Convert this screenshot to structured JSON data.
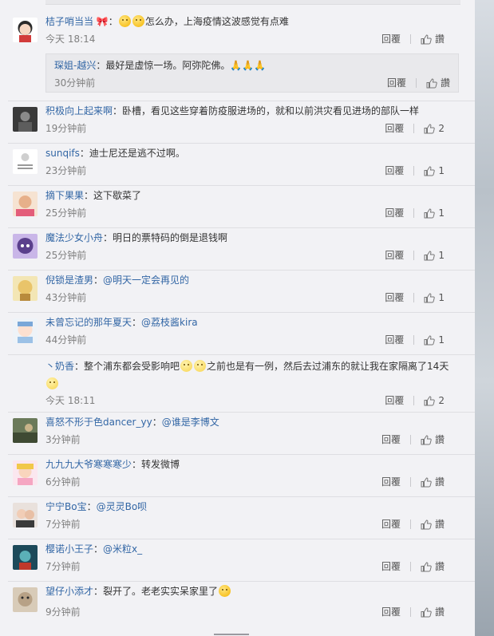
{
  "reply_label": "回覆",
  "like_label": "讚",
  "comments": [
    {
      "user": "桔子哨当当",
      "badge": "🎀",
      "text": "怎么办，上海疫情这波感觉有点难",
      "emoji_before": 2,
      "time": "今天 18:14",
      "likes": "讚",
      "reply": {
        "user": "琛姐-越兴",
        "text": "最好是虚惊一场。阿弥陀佛。🙏🙏🙏",
        "time": "30分钟前",
        "likes": "讚"
      }
    },
    {
      "user": "积极向上起来啊",
      "text": "卧槽，看见这些穿着防疫服进场的，就和以前洪灾看见进场的部队一样",
      "time": "19分钟前",
      "likes": "2"
    },
    {
      "user": "sunqifs",
      "text": "迪士尼还是逃不过啊。",
      "time": "23分钟前",
      "likes": "1"
    },
    {
      "user": "摘下果果",
      "text": "这下歇菜了",
      "time": "25分钟前",
      "likes": "1"
    },
    {
      "user": "魔法少女小舟",
      "text": "明日的票特码的倒是退钱啊",
      "time": "25分钟前",
      "likes": "1"
    },
    {
      "user": "倪锁是渣男",
      "text": "@明天一定会再见的",
      "time": "43分钟前",
      "likes": "1"
    },
    {
      "user": "未曾忘记的那年夏天",
      "text": "@荔枝酱kira",
      "time": "44分钟前",
      "likes": "1"
    },
    {
      "user": "丶奶香",
      "text_a": "整个浦东都会受影响吧",
      "text_b": "之前也是有一例，然后去过浦东的就让我在家隔离了14天",
      "time": "今天 18:11",
      "likes": "2"
    },
    {
      "user": "喜怒不形于色dancer_yy",
      "text": "@谁是李博文",
      "time": "3分钟前",
      "likes": "讚"
    },
    {
      "user": "九九九大爷寒寒寒少",
      "text": "转发微博",
      "time": "6分钟前",
      "likes": "讚"
    },
    {
      "user": "宁宁Bo宝",
      "text": "@灵灵Bo呗",
      "time": "7分钟前",
      "likes": "讚"
    },
    {
      "user": "樱诺小王子",
      "text": "@米粒x_",
      "time": "7分钟前",
      "likes": "讚"
    },
    {
      "user": "望仔小添才",
      "text": "裂开了。老老实实呆家里了",
      "time": "9分钟前",
      "likes": "讚"
    }
  ]
}
